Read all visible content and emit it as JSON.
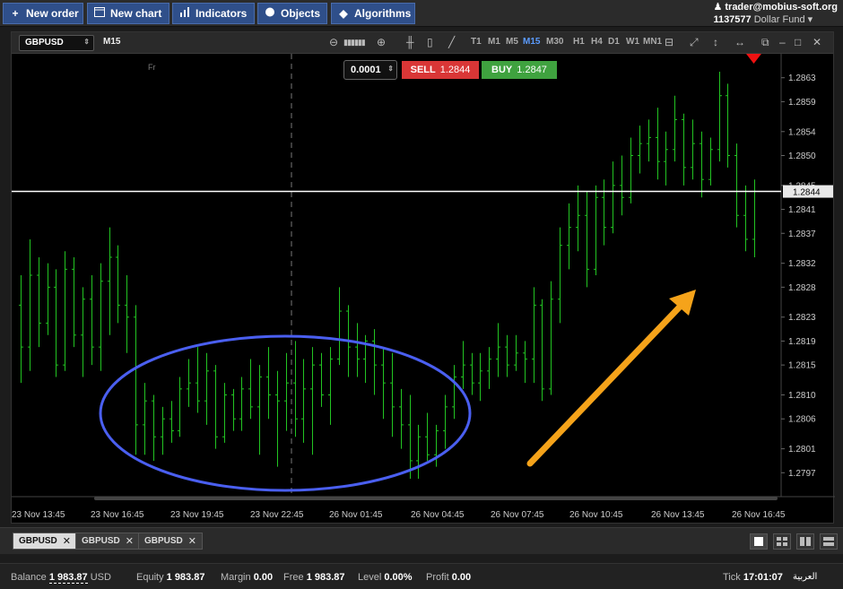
{
  "toolbar": {
    "new_order": "New order",
    "new_chart": "New chart",
    "indicators": "Indicators",
    "objects": "Objects",
    "algorithms": "Algorithms"
  },
  "account": {
    "email": "trader@mobius-soft.org",
    "number": "1137577",
    "fund": "Dollar Fund"
  },
  "chart_header": {
    "symbol": "GBPUSD",
    "timeframe_label": "M15",
    "timeframes": [
      "T1",
      "M1",
      "M5",
      "M15",
      "M30",
      "H1",
      "H4",
      "D1",
      "W1",
      "MN1"
    ],
    "active_timeframe": "M15"
  },
  "trade": {
    "step": "0.0001",
    "sell_label": "SELL",
    "sell_price": "1.2844",
    "buy_label": "BUY",
    "buy_price": "1.2847"
  },
  "chart_data": {
    "type": "ohlc",
    "symbol": "GBPUSD",
    "timeframe": "M15",
    "session_marker": "Fr",
    "current_price": 1.2844,
    "ylim": [
      1.2793,
      1.2867
    ],
    "y_ticks": [
      "1.2863",
      "1.2859",
      "1.2854",
      "1.2850",
      "1.2845",
      "1.2841",
      "1.2837",
      "1.2832",
      "1.2828",
      "1.2823",
      "1.2819",
      "1.2815",
      "1.2810",
      "1.2806",
      "1.2801",
      "1.2797"
    ],
    "x_ticks": [
      "23 Nov 13:45",
      "23 Nov 16:45",
      "23 Nov 19:45",
      "23 Nov 22:45",
      "26 Nov 01:45",
      "26 Nov 04:45",
      "26 Nov 07:45",
      "26 Nov 10:45",
      "26 Nov 13:45",
      "26 Nov 16:45"
    ],
    "bar_color": "#22c422",
    "current_line_color": "#ffffff",
    "annotations": {
      "ellipse_color": "#4a5ff0",
      "arrow_color": "#f5a31a"
    },
    "bars": [
      [
        1.2825,
        1.283,
        1.2812,
        1.2818
      ],
      [
        1.2818,
        1.2836,
        1.2814,
        1.283
      ],
      [
        1.283,
        1.2833,
        1.2818,
        1.2822
      ],
      [
        1.2822,
        1.2832,
        1.282,
        1.2828
      ],
      [
        1.2828,
        1.2831,
        1.2813,
        1.2815
      ],
      [
        1.2815,
        1.2834,
        1.2814,
        1.2831
      ],
      [
        1.2831,
        1.2833,
        1.2818,
        1.282
      ],
      [
        1.282,
        1.2828,
        1.2813,
        1.2826
      ],
      [
        1.2826,
        1.283,
        1.2815,
        1.2818
      ],
      [
        1.2818,
        1.2832,
        1.2814,
        1.2829
      ],
      [
        1.2829,
        1.2838,
        1.282,
        1.2833
      ],
      [
        1.2833,
        1.2835,
        1.2822,
        1.2825
      ],
      [
        1.2825,
        1.283,
        1.2817,
        1.2823
      ],
      [
        1.2823,
        1.2825,
        1.28,
        1.2805
      ],
      [
        1.2805,
        1.2812,
        1.28,
        1.2809
      ],
      [
        1.2809,
        1.281,
        1.2799,
        1.2803
      ],
      [
        1.2803,
        1.2808,
        1.28,
        1.2806
      ],
      [
        1.2806,
        1.2809,
        1.2802,
        1.2804
      ],
      [
        1.2804,
        1.2813,
        1.2803,
        1.2811
      ],
      [
        1.2811,
        1.2816,
        1.2808,
        1.2812
      ],
      [
        1.2812,
        1.2818,
        1.2807,
        1.2809
      ],
      [
        1.2809,
        1.2817,
        1.2805,
        1.2814
      ],
      [
        1.2814,
        1.2815,
        1.2801,
        1.2803
      ],
      [
        1.2803,
        1.2812,
        1.2802,
        1.281
      ],
      [
        1.281,
        1.2811,
        1.2804,
        1.2806
      ],
      [
        1.2806,
        1.2813,
        1.2804,
        1.2811
      ],
      [
        1.2811,
        1.2816,
        1.2806,
        1.2808
      ],
      [
        1.2808,
        1.2815,
        1.28,
        1.2813
      ],
      [
        1.2813,
        1.2818,
        1.2806,
        1.281
      ],
      [
        1.281,
        1.2814,
        1.2798,
        1.2809
      ],
      [
        1.2809,
        1.2817,
        1.2804,
        1.2812
      ],
      [
        1.2812,
        1.2819,
        1.2803,
        1.2806
      ],
      [
        1.2806,
        1.2816,
        1.2802,
        1.2811
      ],
      [
        1.2811,
        1.2818,
        1.28,
        1.2815
      ],
      [
        1.2815,
        1.2817,
        1.2808,
        1.281
      ],
      [
        1.281,
        1.2818,
        1.2805,
        1.2816
      ],
      [
        1.2816,
        1.2828,
        1.2815,
        1.2824
      ],
      [
        1.2824,
        1.2825,
        1.2813,
        1.2818
      ],
      [
        1.2818,
        1.2822,
        1.2813,
        1.2816
      ],
      [
        1.2816,
        1.282,
        1.2812,
        1.2819
      ],
      [
        1.2819,
        1.2821,
        1.281,
        1.2815
      ],
      [
        1.2815,
        1.2818,
        1.2806,
        1.2812
      ],
      [
        1.2812,
        1.2817,
        1.2803,
        1.2808
      ],
      [
        1.2808,
        1.2811,
        1.2801,
        1.2805
      ],
      [
        1.2805,
        1.281,
        1.2796,
        1.2799
      ],
      [
        1.2799,
        1.2805,
        1.2796,
        1.2803
      ],
      [
        1.2803,
        1.2807,
        1.2799,
        1.28
      ],
      [
        1.28,
        1.2805,
        1.2798,
        1.2804
      ],
      [
        1.2804,
        1.281,
        1.2801,
        1.2808
      ],
      [
        1.2808,
        1.2815,
        1.2806,
        1.2813
      ],
      [
        1.2813,
        1.2819,
        1.2811,
        1.2815
      ],
      [
        1.2815,
        1.2817,
        1.281,
        1.2812
      ],
      [
        1.2812,
        1.2817,
        1.2809,
        1.2814
      ],
      [
        1.2814,
        1.2818,
        1.2811,
        1.2816
      ],
      [
        1.2816,
        1.2822,
        1.2813,
        1.2818
      ],
      [
        1.2818,
        1.282,
        1.2813,
        1.2815
      ],
      [
        1.2815,
        1.282,
        1.2814,
        1.2817
      ],
      [
        1.2817,
        1.2819,
        1.2812,
        1.2816
      ],
      [
        1.2816,
        1.2828,
        1.2812,
        1.2825
      ],
      [
        1.2825,
        1.2826,
        1.2809,
        1.2811
      ],
      [
        1.2811,
        1.2829,
        1.281,
        1.2826
      ],
      [
        1.2826,
        1.2838,
        1.2822,
        1.2835
      ],
      [
        1.2835,
        1.2842,
        1.2831,
        1.2838
      ],
      [
        1.2838,
        1.2845,
        1.2834,
        1.284
      ],
      [
        1.284,
        1.2844,
        1.2828,
        1.2831
      ],
      [
        1.2831,
        1.2845,
        1.283,
        1.2843
      ],
      [
        1.2843,
        1.2846,
        1.2835,
        1.2838
      ],
      [
        1.2838,
        1.2849,
        1.2837,
        1.2845
      ],
      [
        1.2845,
        1.285,
        1.284,
        1.2843
      ],
      [
        1.2843,
        1.2853,
        1.2842,
        1.285
      ],
      [
        1.285,
        1.2855,
        1.2847,
        1.2852
      ],
      [
        1.2852,
        1.2856,
        1.2849,
        1.2853
      ],
      [
        1.2853,
        1.2858,
        1.2846,
        1.2849
      ],
      [
        1.2849,
        1.2854,
        1.2845,
        1.2851
      ],
      [
        1.2851,
        1.286,
        1.2849,
        1.2856
      ],
      [
        1.2856,
        1.2857,
        1.2845,
        1.2848
      ],
      [
        1.2848,
        1.2856,
        1.2846,
        1.2852
      ],
      [
        1.2852,
        1.2854,
        1.2843,
        1.2846
      ],
      [
        1.2846,
        1.2853,
        1.2845,
        1.2851
      ],
      [
        1.2851,
        1.2864,
        1.2849,
        1.286
      ],
      [
        1.286,
        1.2862,
        1.2848,
        1.285
      ],
      [
        1.285,
        1.2852,
        1.2838,
        1.284
      ],
      [
        1.284,
        1.2845,
        1.2834,
        1.2836
      ],
      [
        1.2836,
        1.2846,
        1.2833,
        1.2844
      ]
    ]
  },
  "tabs": [
    {
      "label": "GBPUSD",
      "active": true
    },
    {
      "label": "GBPUSD",
      "active": false
    },
    {
      "label": "GBPUSD",
      "active": false
    }
  ],
  "status": {
    "balance_label": "Balance",
    "balance": "1 983.87",
    "balance_ccy": "USD",
    "equity_label": "Equity",
    "equity": "1 983.87",
    "margin_label": "Margin",
    "margin": "0.00",
    "free_label": "Free",
    "free": "1 983.87",
    "level_label": "Level",
    "level": "0.00%",
    "profit_label": "Profit",
    "profit": "0.00",
    "tick_label": "Tick",
    "tick_time": "17:01:07",
    "locale": "العربية"
  }
}
